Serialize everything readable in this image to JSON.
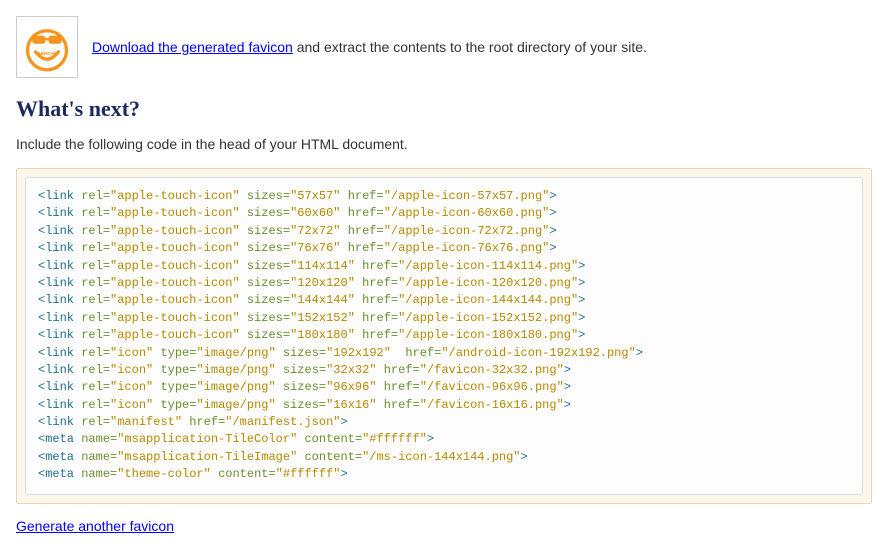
{
  "download": {
    "link_text": "Download the generated favicon",
    "after_text": " and extract the contents to the root directory of your site."
  },
  "heading": "What's next?",
  "instruction": "Include the following code in the head of your HTML document.",
  "code_lines": [
    {
      "tag": "link",
      "attrs": [
        [
          "rel",
          "apple-touch-icon"
        ],
        [
          "sizes",
          "57x57"
        ],
        [
          "href",
          "/apple-icon-57x57.png"
        ]
      ]
    },
    {
      "tag": "link",
      "attrs": [
        [
          "rel",
          "apple-touch-icon"
        ],
        [
          "sizes",
          "60x60"
        ],
        [
          "href",
          "/apple-icon-60x60.png"
        ]
      ]
    },
    {
      "tag": "link",
      "attrs": [
        [
          "rel",
          "apple-touch-icon"
        ],
        [
          "sizes",
          "72x72"
        ],
        [
          "href",
          "/apple-icon-72x72.png"
        ]
      ]
    },
    {
      "tag": "link",
      "attrs": [
        [
          "rel",
          "apple-touch-icon"
        ],
        [
          "sizes",
          "76x76"
        ],
        [
          "href",
          "/apple-icon-76x76.png"
        ]
      ]
    },
    {
      "tag": "link",
      "attrs": [
        [
          "rel",
          "apple-touch-icon"
        ],
        [
          "sizes",
          "114x114"
        ],
        [
          "href",
          "/apple-icon-114x114.png"
        ]
      ]
    },
    {
      "tag": "link",
      "attrs": [
        [
          "rel",
          "apple-touch-icon"
        ],
        [
          "sizes",
          "120x120"
        ],
        [
          "href",
          "/apple-icon-120x120.png"
        ]
      ]
    },
    {
      "tag": "link",
      "attrs": [
        [
          "rel",
          "apple-touch-icon"
        ],
        [
          "sizes",
          "144x144"
        ],
        [
          "href",
          "/apple-icon-144x144.png"
        ]
      ]
    },
    {
      "tag": "link",
      "attrs": [
        [
          "rel",
          "apple-touch-icon"
        ],
        [
          "sizes",
          "152x152"
        ],
        [
          "href",
          "/apple-icon-152x152.png"
        ]
      ]
    },
    {
      "tag": "link",
      "attrs": [
        [
          "rel",
          "apple-touch-icon"
        ],
        [
          "sizes",
          "180x180"
        ],
        [
          "href",
          "/apple-icon-180x180.png"
        ]
      ]
    },
    {
      "tag": "link",
      "attrs": [
        [
          "rel",
          "icon"
        ],
        [
          "type",
          "image/png"
        ],
        [
          "sizes",
          "192x192"
        ],
        [
          "href",
          "/android-icon-192x192.png"
        ]
      ],
      "extra_space_before": "href"
    },
    {
      "tag": "link",
      "attrs": [
        [
          "rel",
          "icon"
        ],
        [
          "type",
          "image/png"
        ],
        [
          "sizes",
          "32x32"
        ],
        [
          "href",
          "/favicon-32x32.png"
        ]
      ]
    },
    {
      "tag": "link",
      "attrs": [
        [
          "rel",
          "icon"
        ],
        [
          "type",
          "image/png"
        ],
        [
          "sizes",
          "96x96"
        ],
        [
          "href",
          "/favicon-96x96.png"
        ]
      ]
    },
    {
      "tag": "link",
      "attrs": [
        [
          "rel",
          "icon"
        ],
        [
          "type",
          "image/png"
        ],
        [
          "sizes",
          "16x16"
        ],
        [
          "href",
          "/favicon-16x16.png"
        ]
      ]
    },
    {
      "tag": "link",
      "attrs": [
        [
          "rel",
          "manifest"
        ],
        [
          "href",
          "/manifest.json"
        ]
      ]
    },
    {
      "tag": "meta",
      "attrs": [
        [
          "name",
          "msapplication-TileColor"
        ],
        [
          "content",
          "#ffffff"
        ]
      ]
    },
    {
      "tag": "meta",
      "attrs": [
        [
          "name",
          "msapplication-TileImage"
        ],
        [
          "content",
          "/ms-icon-144x144.png"
        ]
      ]
    },
    {
      "tag": "meta",
      "attrs": [
        [
          "name",
          "theme-color"
        ],
        [
          "content",
          "#ffffff"
        ]
      ]
    }
  ],
  "footer_link": "Generate another favicon"
}
